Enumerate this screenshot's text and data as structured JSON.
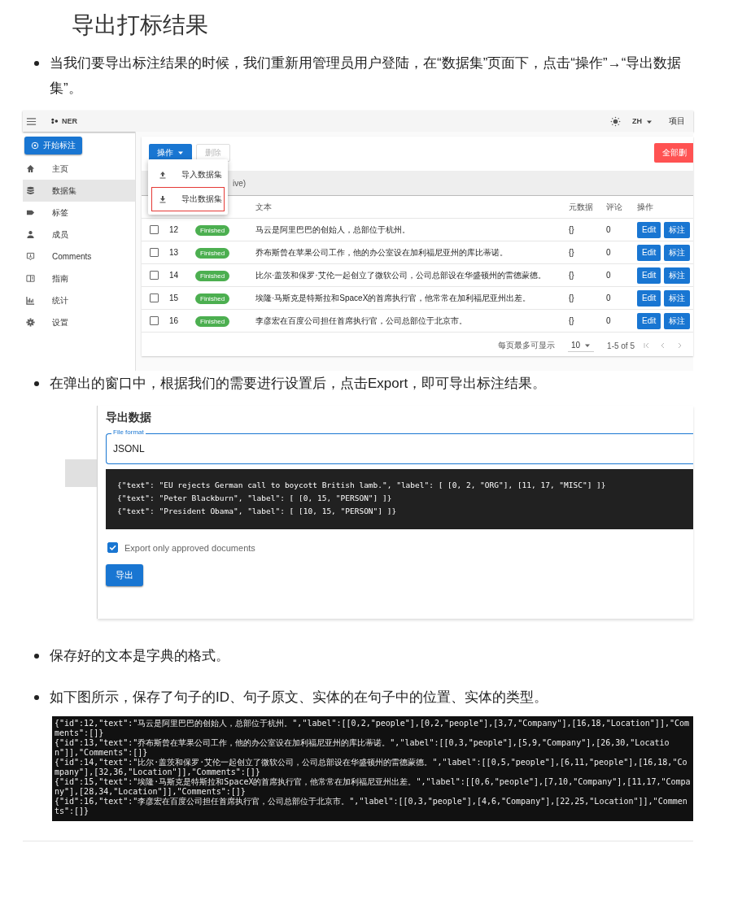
{
  "title": "导出打标结果",
  "bullet_1": "当我们要导出标注结果的时候，我们重新用管理员用户登陆，在“数据集”页面下，点击“操作”→“导出数据集”。",
  "app_screenshot": {
    "app_bar": {
      "logo_text": "NER",
      "language": "ZH",
      "projects_link": "项目"
    },
    "start_button": "开始标注",
    "sidebar": [
      {
        "label": "主页",
        "selected": false
      },
      {
        "label": "数据集",
        "selected": true
      },
      {
        "label": "标签",
        "selected": false
      },
      {
        "label": "成员",
        "selected": false
      },
      {
        "label": "Comments",
        "selected": false
      },
      {
        "label": "指南",
        "selected": false
      },
      {
        "label": "统计",
        "selected": false
      },
      {
        "label": "设置",
        "selected": false
      }
    ],
    "toolbar": {
      "actions_button": "操作",
      "delete_button": {
        "label": "删除",
        "disabled": true
      },
      "delete_all_button": "全部删"
    },
    "actions_menu": [
      {
        "label": "导入数据集",
        "outlined": false
      },
      {
        "label": "导出数据集",
        "outlined": true
      }
    ],
    "filter_text": "ive)",
    "table": {
      "columns": [
        "文本",
        "元数据",
        "评论",
        "操作"
      ],
      "rows": [
        {
          "checked": false,
          "id": "12",
          "status": "Finished",
          "text": "马云是阿里巴巴的创始人，总部位于杭州。",
          "metadata": "{}",
          "comments": "0",
          "edit_button": "Edit",
          "annotate_button": "标注"
        },
        {
          "checked": false,
          "id": "13",
          "status": "Finished",
          "text": "乔布斯曾在苹果公司工作，他的办公室设在加利福尼亚州的库比蒂诺。",
          "metadata": "{}",
          "comments": "0",
          "edit_button": "Edit",
          "annotate_button": "标注"
        },
        {
          "checked": false,
          "id": "14",
          "status": "Finished",
          "text": "比尔·盖茨和保罗·艾伦一起创立了微软公司，公司总部设在华盛顿州的雷德蒙德。",
          "metadata": "{}",
          "comments": "0",
          "edit_button": "Edit",
          "annotate_button": "标注"
        },
        {
          "checked": false,
          "id": "15",
          "status": "Finished",
          "text": "埃隆·马斯克是特斯拉和SpaceX的首席执行官，他常常在加利福尼亚州出差。",
          "metadata": "{}",
          "comments": "0",
          "edit_button": "Edit",
          "annotate_button": "标注"
        },
        {
          "checked": false,
          "id": "16",
          "status": "Finished",
          "text": "李彦宏在百度公司担任首席执行官，公司总部位于北京市。",
          "metadata": "{}",
          "comments": "0",
          "edit_button": "Edit",
          "annotate_button": "标注"
        }
      ]
    },
    "pagination": {
      "rows_per_page_label": "每页最多可显示",
      "rows_per_page": "10",
      "range": "1-5 of 5"
    }
  },
  "bullet_2": "在弹出的窗口中，根据我们的需要进行设置后，点击Export，即可导出标注结果。",
  "export_dialog": {
    "title": "导出数据",
    "format_field": {
      "label": "File format",
      "value": "JSONL"
    },
    "example_lines": [
      "{\"text\": \"EU rejects German call to boycott British lamb.\", \"label\": [ [0, 2, \"ORG\"], [11, 17, \"MISC\"] ]}",
      "{\"text\": \"Peter Blackburn\", \"label\": [ [0, 15, \"PERSON\"] ]}",
      "{\"text\": \"President Obama\", \"label\": [ [10, 15, \"PERSON\"] ]}"
    ],
    "approved_only": {
      "label": "Export only approved documents",
      "checked": true
    },
    "export_button": "导出"
  },
  "bullet_3": "保存好的文本是字典的格式。",
  "bullet_4": "如下图所示，保存了句子的ID、句子原文、实体的在句子中的位置、实体的类型。",
  "output_lines": [
    "{\"id\":12,\"text\":\"马云是阿里巴巴的创始人，总部位于杭州。\",\"label\":[[0,2,\"people\"],[0,2,\"people\"],[3,7,\"Company\"],[16,18,\"Location\"]],\"Comments\":[]}",
    "{\"id\":13,\"text\":\"乔布斯曾在苹果公司工作，他的办公室设在加利福尼亚州的库比蒂诺。\",\"label\":[[0,3,\"people\"],[5,9,\"Company\"],[26,30,\"Location\"]],\"Comments\":[]}",
    "{\"id\":14,\"text\":\"比尔·盖茨和保罗·艾伦一起创立了微软公司，公司总部设在华盛顿州的雷德蒙德。\",\"label\":[[0,5,\"people\"],[6,11,\"people\"],[16,18,\"Company\"],[32,36,\"Location\"]],\"Comments\":[]}",
    "{\"id\":15,\"text\":\"埃隆·马斯克是特斯拉和SpaceX的首席执行官，他常常在加利福尼亚州出差。\",\"label\":[[0,6,\"people\"],[7,10,\"Company\"],[11,17,\"Company\"],[28,34,\"Location\"]],\"Comments\":[]}",
    "{\"id\":16,\"text\":\"李彦宏在百度公司担任首席执行官，公司总部位于北京市。\",\"label\":[[0,3,\"people\"],[4,6,\"Company\"],[22,25,\"Location\"]],\"Comments\":[]}"
  ]
}
